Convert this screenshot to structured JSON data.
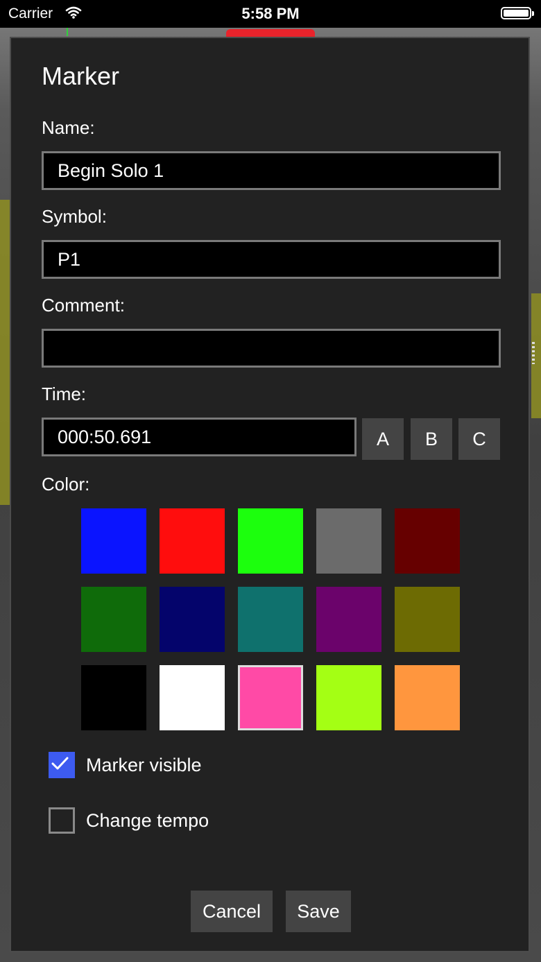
{
  "status_bar": {
    "carrier": "Carrier",
    "time": "5:58 PM",
    "wifi_icon": "wifi-icon",
    "battery_icon": "battery-icon"
  },
  "dialog": {
    "title": "Marker",
    "name": {
      "label": "Name:",
      "value": "Begin Solo 1"
    },
    "symbol": {
      "label": "Symbol:",
      "value": "P1"
    },
    "comment": {
      "label": "Comment:",
      "value": ""
    },
    "time": {
      "label": "Time:",
      "value": "000:50.691",
      "buttons": [
        "A",
        "B",
        "C"
      ]
    },
    "color": {
      "label": "Color:",
      "swatches": [
        "#0a14ff",
        "#ff0d0d",
        "#1cff0d",
        "#6b6b6b",
        "#660000",
        "#0f6b0a",
        "#04046b",
        "#0f716d",
        "#6b036b",
        "#6d6b03",
        "#000000",
        "#ffffff",
        "#ff4aa6",
        "#a4ff14",
        "#ff963e"
      ],
      "selected_index": 12
    },
    "marker_visible": {
      "label": "Marker visible",
      "checked": true
    },
    "change_tempo": {
      "label": "Change tempo",
      "checked": false
    },
    "actions": {
      "cancel": "Cancel",
      "save": "Save"
    }
  },
  "colors": {
    "dialog_bg": "#222222",
    "field_border": "#7a7a7a",
    "button_bg": "#444444",
    "check_on": "#3d5bf0"
  }
}
